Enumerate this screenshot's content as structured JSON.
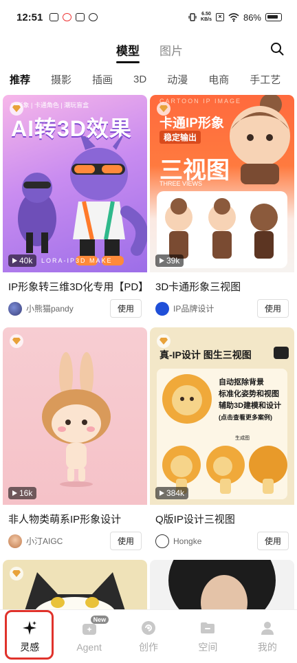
{
  "status_bar": {
    "time": "12:51",
    "net_speed_top": "6.50",
    "net_speed_bottom": "KB/s",
    "battery_pct": "86%"
  },
  "top_tabs": [
    {
      "label": "模型",
      "active": true
    },
    {
      "label": "图片",
      "active": false
    }
  ],
  "categories": [
    "推荐",
    "摄影",
    "插画",
    "3D",
    "动漫",
    "电商",
    "手工艺"
  ],
  "cards": [
    {
      "title": "IP形象转三维3D化专用【PD】",
      "author": "小熊猫pandy",
      "plays": "40k",
      "use_label": "使用",
      "overlay_tag": "IP形象 | 卡通角色 | 潮玩盲盒",
      "overlay_title": "AI转3D效果",
      "overlay_sub": "LORA-IP3D MAKE"
    },
    {
      "title": "3D卡通形象三视图",
      "author": "IP品牌设计",
      "plays": "39k",
      "use_label": "使用",
      "overlay_top": "CARTOON IP IMAGE",
      "overlay_title": "卡通IP形象",
      "overlay_sub": "稳定输出",
      "overlay_big": "三视图",
      "overlay_small": "THREE VIEWS"
    },
    {
      "title": "非人物类萌系IP形象设计",
      "author": "小汀AIGC",
      "plays": "16k",
      "use_label": "使用"
    },
    {
      "title": "Q版IP设计三视图",
      "author": "Hongke",
      "plays": "384k",
      "use_label": "使用",
      "overlay_title": "真-IP设计 图生三视图",
      "overlay_lines": [
        "自动抠除背景",
        "标准化姿势和视图",
        "辅助3D建模和设计",
        "(点击查看更多案例)"
      ],
      "overlay_label": "生成图"
    }
  ],
  "bottom_nav": [
    {
      "label": "灵感",
      "active": true,
      "icon": "sparkle-icon"
    },
    {
      "label": "Agent",
      "active": false,
      "icon": "agent-icon",
      "badge": "New"
    },
    {
      "label": "创作",
      "active": false,
      "icon": "create-icon"
    },
    {
      "label": "空间",
      "active": false,
      "icon": "folder-icon"
    },
    {
      "label": "我的",
      "active": false,
      "icon": "profile-icon"
    }
  ]
}
